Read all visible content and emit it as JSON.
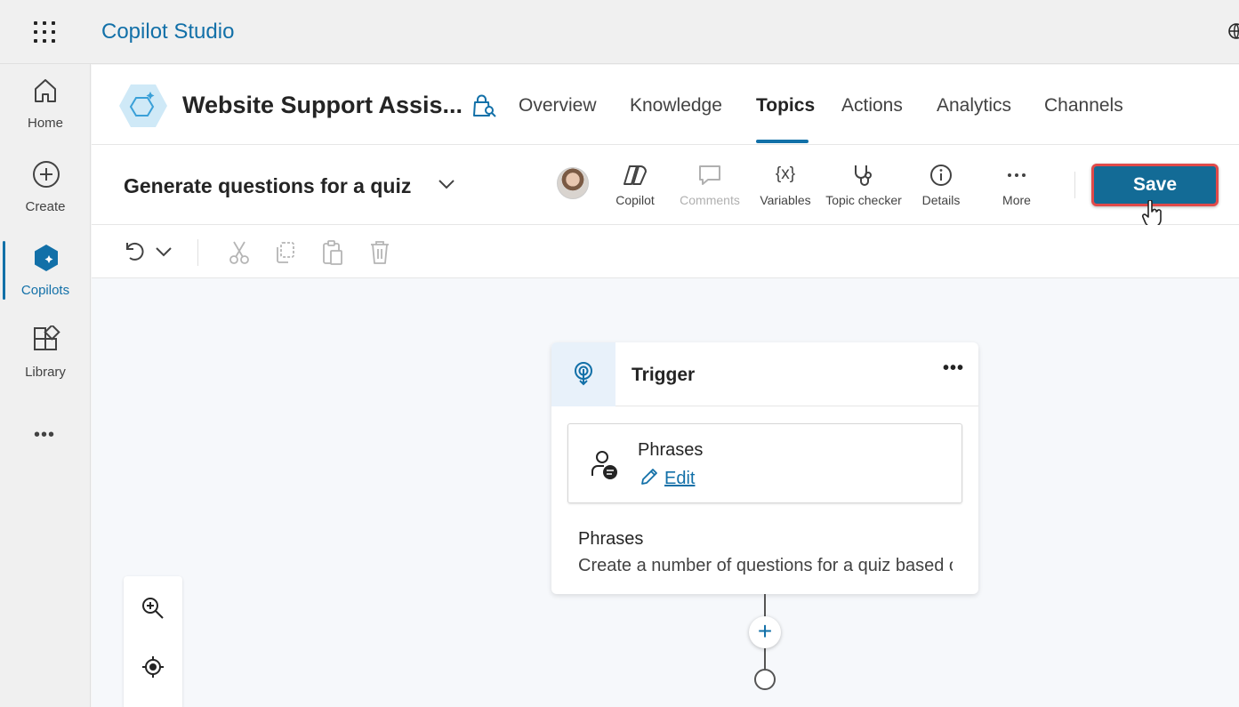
{
  "app": {
    "title": "Copilot Studio"
  },
  "rail": {
    "items": [
      {
        "label": "Home",
        "icon": "home-icon"
      },
      {
        "label": "Create",
        "icon": "add-circle-icon"
      },
      {
        "label": "Copilots",
        "icon": "copilot-icon",
        "active": true
      },
      {
        "label": "Library",
        "icon": "library-icon"
      }
    ],
    "more": "•••"
  },
  "header": {
    "bot_name": "Website Support Assis...",
    "tabs": [
      {
        "label": "Overview"
      },
      {
        "label": "Knowledge"
      },
      {
        "label": "Topics",
        "active": true
      },
      {
        "label": "Actions"
      },
      {
        "label": "Analytics"
      },
      {
        "label": "Channels"
      }
    ]
  },
  "topic": {
    "name": "Generate questions for a quiz",
    "tools": {
      "copilot": "Copilot",
      "comments": "Comments",
      "variables": "Variables",
      "variables_glyph": "{x}",
      "topic_checker": "Topic checker",
      "details": "Details",
      "more": "More"
    },
    "save_label": "Save"
  },
  "trigger_card": {
    "title": "Trigger",
    "more": "•••",
    "phrases_label": "Phrases",
    "edit_label": "Edit",
    "desc_title": "Phrases",
    "desc_text": "Create a number of questions for a quiz based on a topic"
  },
  "colors": {
    "brand": "#1270a8",
    "save_button": "#136b96",
    "save_highlight": "#e04a4a"
  }
}
